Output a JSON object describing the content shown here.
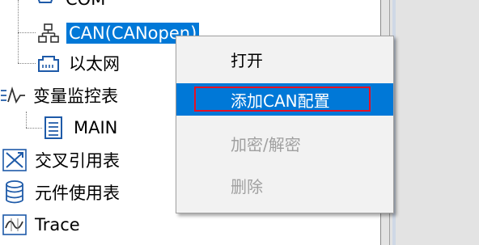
{
  "tree": {
    "com": {
      "label": "COM",
      "icon": "com-port-icon"
    },
    "can": {
      "label": "CAN(CANopen)",
      "icon": "network-tree-icon",
      "selected": true
    },
    "ethernet": {
      "label": "以太网",
      "icon": "ethernet-port-icon"
    },
    "var_monitor": {
      "label": "变量监控表",
      "icon": "monitor-wave-icon"
    },
    "main": {
      "label": "MAIN",
      "icon": "document-list-icon"
    },
    "cross_ref": {
      "label": "交叉引用表",
      "icon": "cross-reference-icon"
    },
    "component_usage": {
      "label": "元件使用表",
      "icon": "database-icon"
    },
    "trace": {
      "label": "Trace",
      "icon": "trace-wave-icon"
    }
  },
  "context_menu": {
    "items": [
      {
        "label": "打开",
        "enabled": true
      },
      {
        "label": "添加CAN配置",
        "enabled": true,
        "highlighted": true
      },
      {
        "label": "加密/解密",
        "enabled": false
      },
      {
        "label": "删除",
        "enabled": false
      }
    ]
  },
  "colors": {
    "selection": "#0078d7",
    "annotation_box": "#e81123",
    "disabled_text": "#a0a0a0",
    "menu_bg": "#f2f2f2"
  }
}
